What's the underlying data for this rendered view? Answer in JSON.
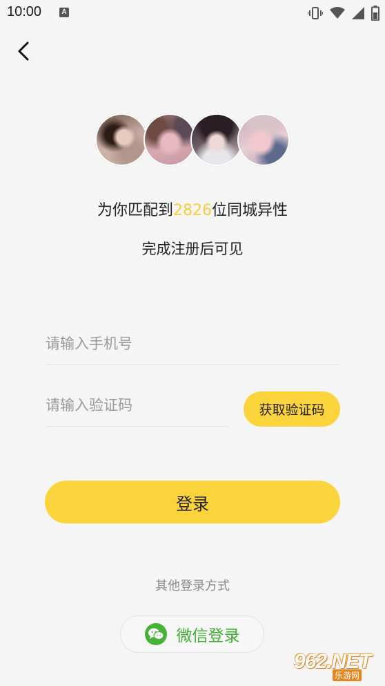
{
  "status_bar": {
    "time": "10:00",
    "app_icon_glyph": "A",
    "icons": [
      "vibrate-icon",
      "wifi-icon",
      "cell-signal-icon",
      "battery-icon"
    ]
  },
  "nav": {
    "back_icon": "chevron-left-icon"
  },
  "match": {
    "prefix": "为你匹配到",
    "count": "2826",
    "suffix": "位同城异性",
    "subtitle": "完成注册后可见",
    "highlight_color": "#f5cd39"
  },
  "form": {
    "phone_placeholder": "请输入手机号",
    "phone_value": "",
    "code_placeholder": "请输入验证码",
    "code_value": "",
    "get_code_label": "获取验证码",
    "login_label": "登录"
  },
  "alt_login": {
    "label": "其他登录方式",
    "wechat_label": "微信登录",
    "wechat_icon": "wechat-icon"
  },
  "watermark": {
    "main": "962.NET",
    "sub": "乐游网"
  },
  "colors": {
    "accent": "#fbd43c",
    "wechat_green": "#44b336",
    "background": "#f5f5f5"
  }
}
